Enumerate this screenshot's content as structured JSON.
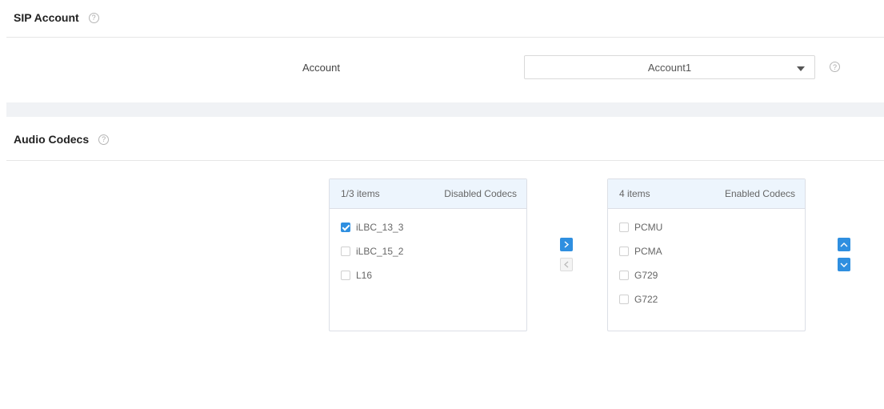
{
  "sip_section": {
    "title": "SIP Account",
    "help": "?"
  },
  "account": {
    "label": "Account",
    "value": "Account1",
    "help": "?"
  },
  "codec_section": {
    "title": "Audio Codecs",
    "help": "?"
  },
  "disabled_panel": {
    "count": "1/3 items",
    "title": "Disabled Codecs",
    "items": [
      {
        "label": "iLBC_13_3",
        "checked": true
      },
      {
        "label": "iLBC_15_2",
        "checked": false
      },
      {
        "label": "L16",
        "checked": false
      }
    ]
  },
  "enabled_panel": {
    "count": "4 items",
    "title": "Enabled Codecs",
    "items": [
      {
        "label": "PCMU",
        "checked": false
      },
      {
        "label": "PCMA",
        "checked": false
      },
      {
        "label": "G729",
        "checked": false
      },
      {
        "label": "G722",
        "checked": false
      }
    ]
  },
  "colors": {
    "accent": "#2f8fe0",
    "panel_header": "#edf5fd",
    "band": "#f0f2f5"
  },
  "icons": {
    "move_right": "chevron-right-icon",
    "move_left": "chevron-left-icon",
    "move_up": "chevron-up-icon",
    "move_down": "chevron-down-icon",
    "dropdown": "caret-down-icon"
  }
}
